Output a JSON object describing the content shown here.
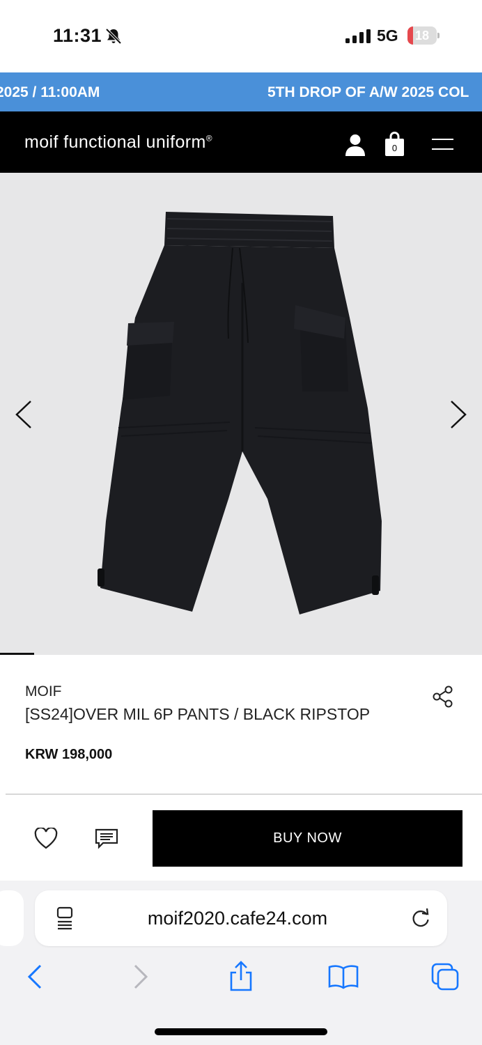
{
  "status_bar": {
    "time": "11:31",
    "network": "5G",
    "battery_level": "18",
    "battery_fraction": 0.18,
    "icons": [
      "bell-slash-icon",
      "signal-icon",
      "battery-icon"
    ]
  },
  "marquee": {
    "left_text": "2025 / 11:00AM",
    "right_text": "5TH DROP OF A/W 2025 COL",
    "background_color": "#4a90d9"
  },
  "header": {
    "logo": "moif functional uniform",
    "logo_mark": "®",
    "cart_count": "0",
    "icons": [
      "user-icon",
      "shopping-bag-icon",
      "menu-icon"
    ]
  },
  "gallery": {
    "background_color": "#e7e7e8",
    "image_icon": "black-cargo-pants-image",
    "prev_icon": "chevron-left-icon",
    "next_icon": "chevron-right-icon"
  },
  "product": {
    "brand": "MOIF",
    "name": "[SS24]OVER MIL 6P PANTS / BLACK RIPSTOP",
    "price": "KRW 198,000"
  },
  "actions": {
    "buy_label": "BUY NOW",
    "icons": [
      "heart-icon",
      "review-icon"
    ]
  },
  "browser": {
    "url": "moif2020.cafe24.com",
    "icons": [
      "reader-icon",
      "reload-icon",
      "back-icon",
      "forward-icon",
      "share-icon",
      "bookmarks-icon",
      "tabs-icon"
    ],
    "accent_color": "#1677ff"
  }
}
